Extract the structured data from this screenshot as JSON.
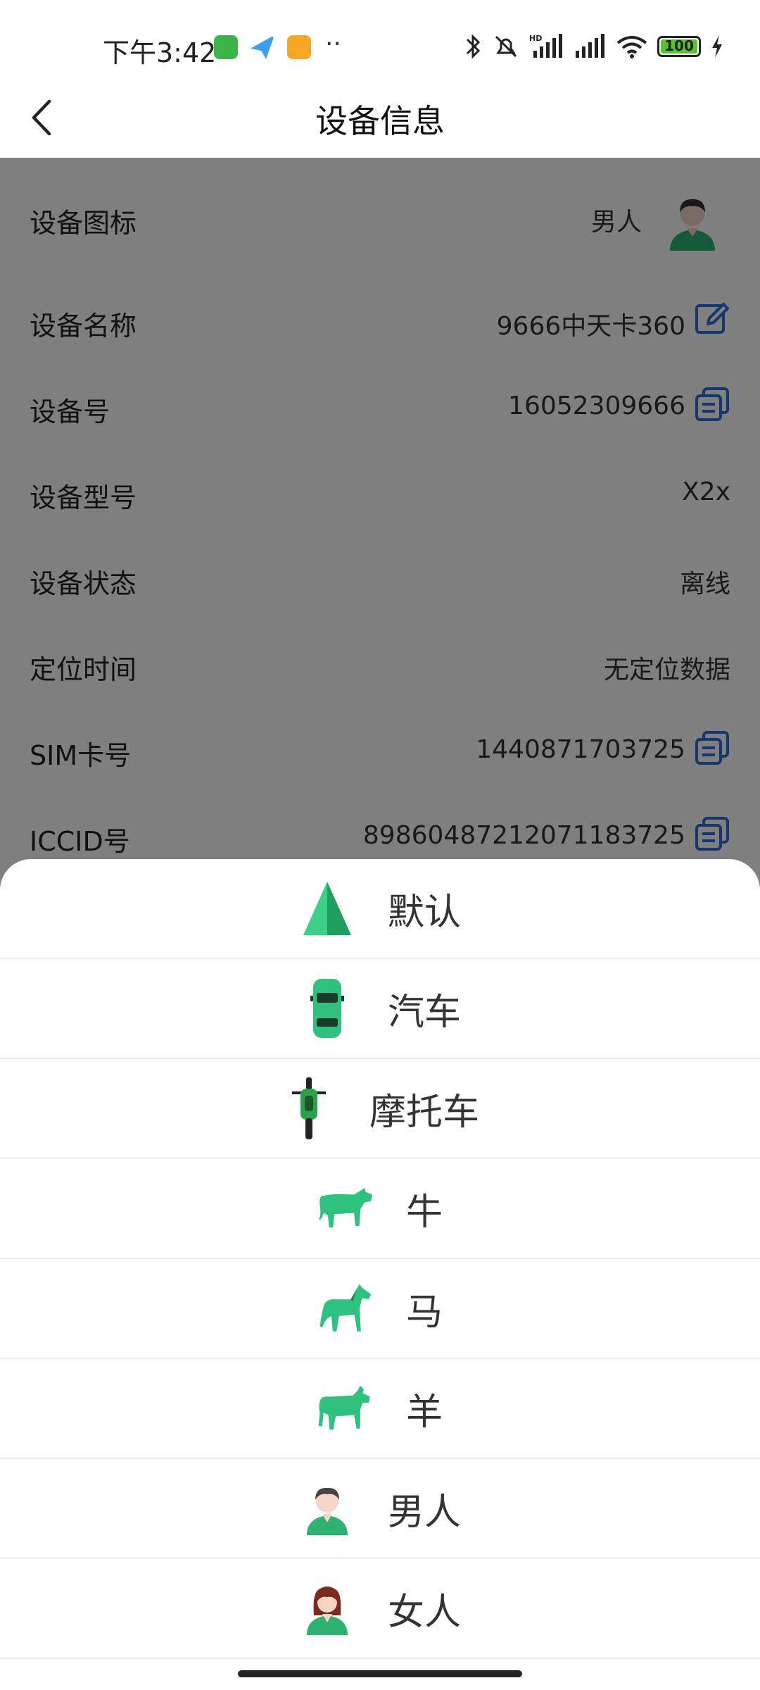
{
  "status_bar": {
    "time": "下午3:42",
    "more": "··",
    "battery": "100"
  },
  "header": {
    "title": "设备信息"
  },
  "info": {
    "icon_label": "设备图标",
    "icon_value": "男人",
    "name_label": "设备名称",
    "name_value": "9666中天卡360",
    "id_label": "设备号",
    "id_value": "16052309666",
    "model_label": "设备型号",
    "model_value": "X2x",
    "state_label": "设备状态",
    "state_value": "离线",
    "loc_label": "定位时间",
    "loc_value": "无定位数据",
    "sim_label": "SIM卡号",
    "sim_value": "1440871703725",
    "iccid_label": "ICCID号",
    "iccid_value": "89860487212071183725"
  },
  "sheet": {
    "options": [
      "默认",
      "汽车",
      "摩托车",
      "牛",
      "马",
      "羊",
      "男人",
      "女人"
    ]
  },
  "colors": {
    "accent": "#2a6fdb",
    "green": "#2ec27e"
  }
}
